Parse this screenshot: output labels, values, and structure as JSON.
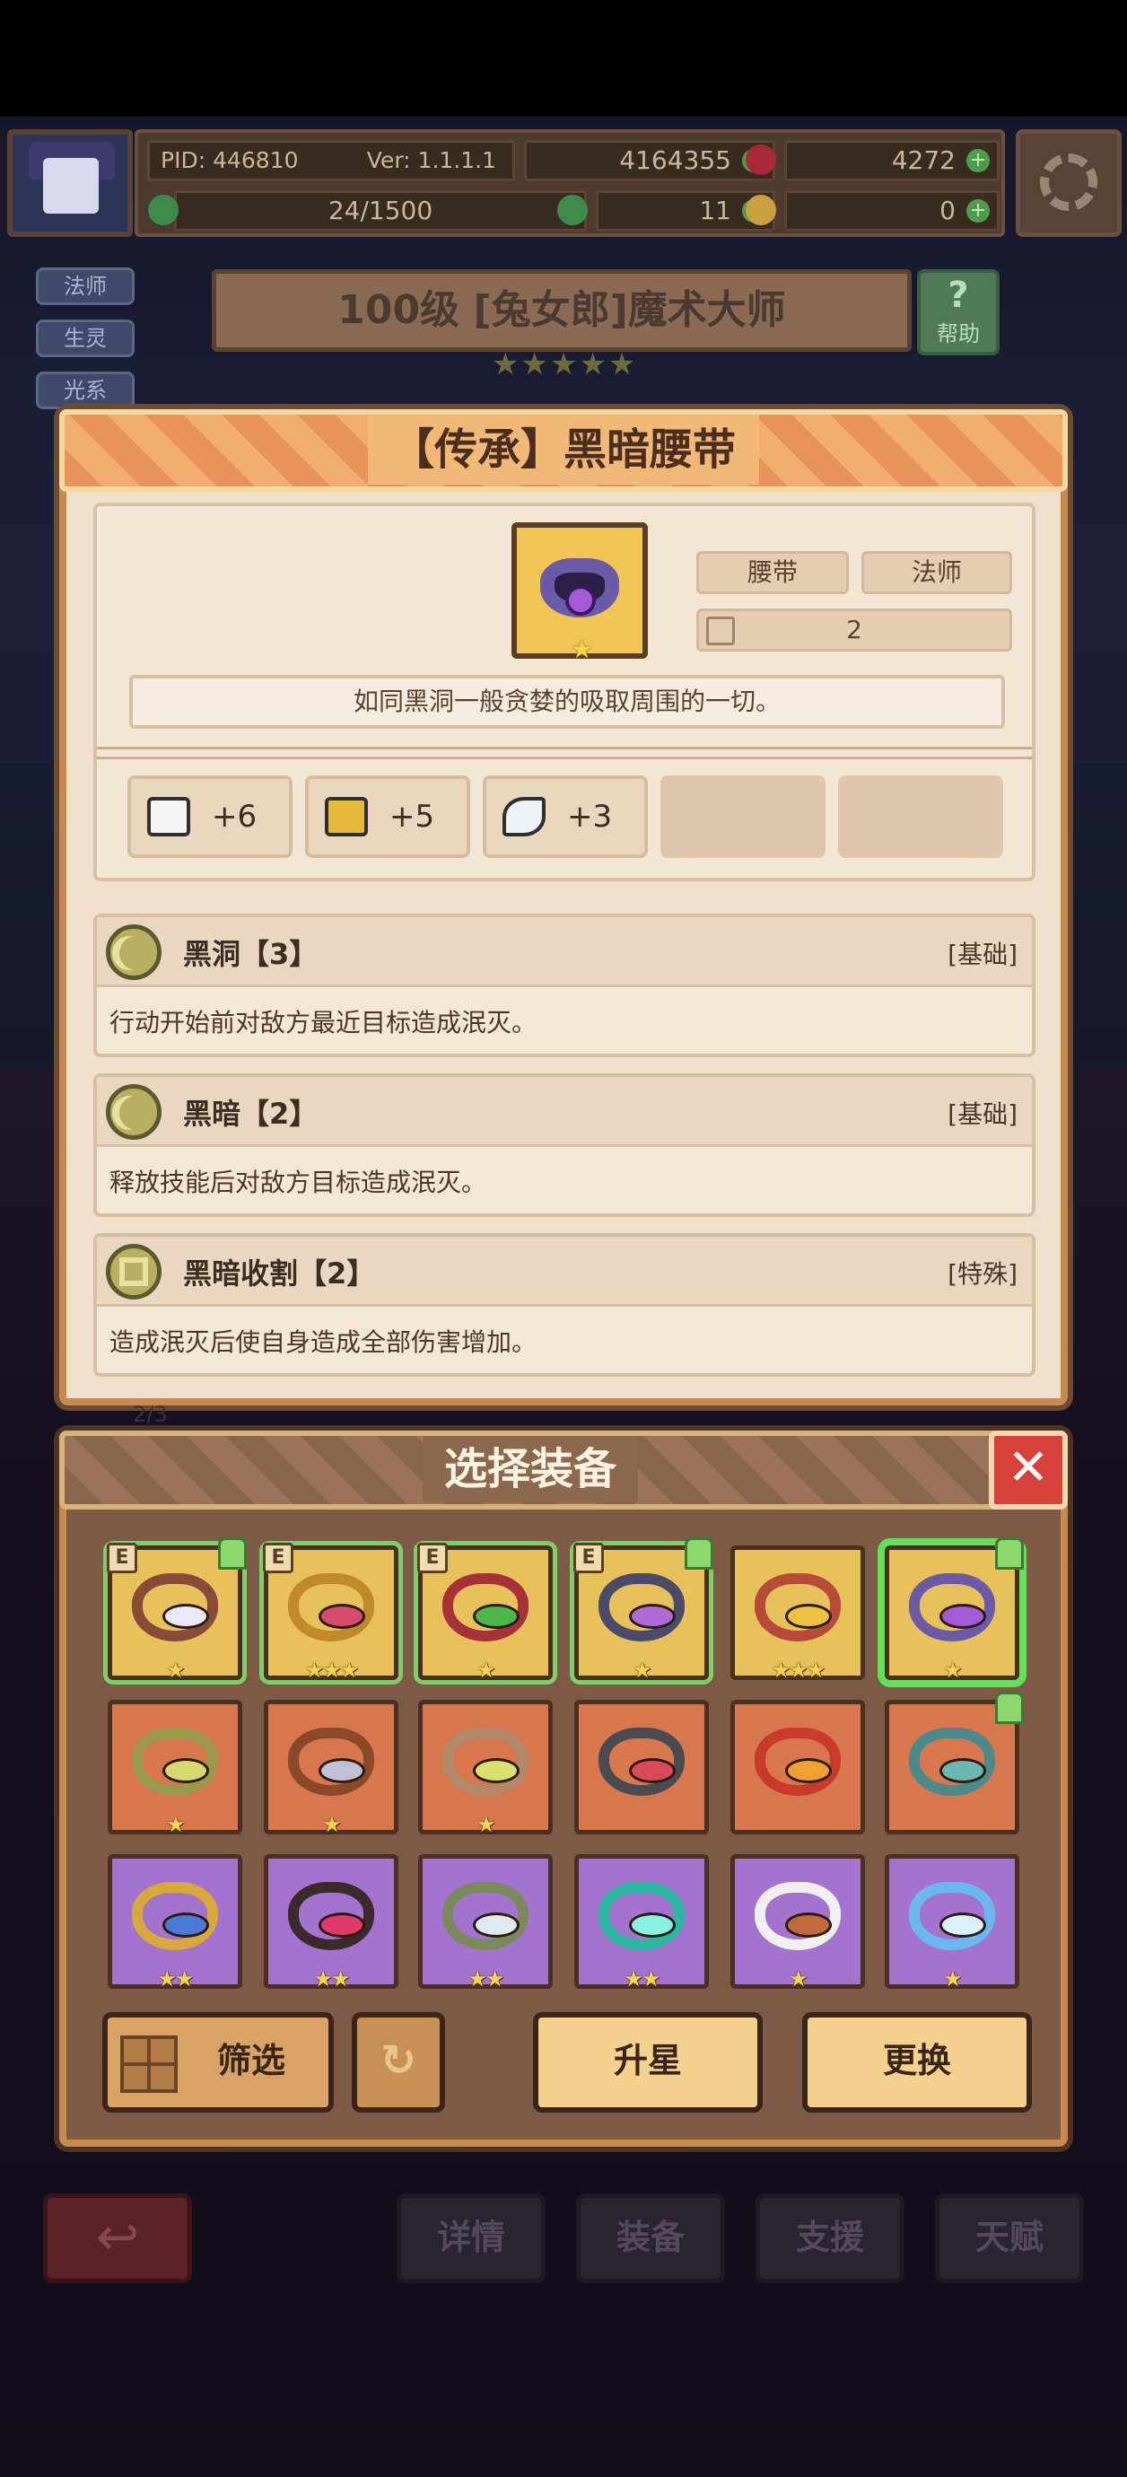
{
  "hud": {
    "pid": "PID: 446810",
    "version": "Ver: 1.1.1.1",
    "gold": "4164355",
    "gems": "4272",
    "energy": "24/1500",
    "clover": "11",
    "keys": "0"
  },
  "hero": {
    "tags": [
      "法师",
      "生灵",
      "光系"
    ],
    "title": "100级 [兔女郎]魔术大师",
    "stars": "★★★★★",
    "help_label": "帮助",
    "help_glyph": "?"
  },
  "item_detail": {
    "title": "【传承】黑暗腰带",
    "type": "腰带",
    "class": "法师",
    "owned_count": "2",
    "icon_star": "★",
    "description": "如同黑洞一般贪婪的吸取周围的一切。",
    "stats": [
      {
        "icon": "book-icon",
        "value": "+6"
      },
      {
        "icon": "boot-icon",
        "value": "+5"
      },
      {
        "icon": "feather-icon",
        "value": "+3"
      }
    ],
    "skills": [
      {
        "icon": "moon-icon",
        "name": "黑洞【3】",
        "type": "[基础]",
        "desc": "行动开始前对敌方最近目标造成泯灭。"
      },
      {
        "icon": "moon-icon",
        "name": "黑暗【2】",
        "type": "[基础]",
        "desc": "释放技能后对敌方目标造成泯灭。"
      },
      {
        "icon": "square-ring-icon",
        "name": "黑暗收割【2】",
        "type": "[特殊]",
        "desc": "造成泯灭后使自身造成全部伤害增加。"
      }
    ]
  },
  "select_panel": {
    "title": "选择装备",
    "close_glyph": "✕",
    "equipped_badge": "E",
    "slots": [
      {
        "rarity": "gold",
        "equipped": true,
        "upgrade": true,
        "stars": "★",
        "band": "#8a4a3a",
        "gem": "#e9e9f5"
      },
      {
        "rarity": "gold",
        "equipped": true,
        "upgrade": false,
        "stars": "★★★",
        "band": "#c08a2a",
        "gem": "#d64a6a"
      },
      {
        "rarity": "gold",
        "equipped": true,
        "upgrade": false,
        "stars": "★",
        "band": "#a8303a",
        "gem": "#4ab84a"
      },
      {
        "rarity": "gold",
        "equipped": true,
        "upgrade": true,
        "stars": "★",
        "band": "#4a4a6a",
        "gem": "#b06ad8"
      },
      {
        "rarity": "gold",
        "equipped": false,
        "upgrade": false,
        "stars": "★★★",
        "band": "#b84a3a",
        "gem": "#f0c040"
      },
      {
        "rarity": "gold",
        "equipped": false,
        "upgrade": true,
        "selected": true,
        "stars": "★",
        "band": "#6b5aa8",
        "gem": "#a35ad6"
      },
      {
        "rarity": "orange",
        "equipped": false,
        "upgrade": false,
        "stars": "★",
        "band": "#9a9a4a",
        "gem": "#d8d870"
      },
      {
        "rarity": "orange",
        "equipped": false,
        "upgrade": false,
        "stars": "★",
        "band": "#8a4a2a",
        "gem": "#c0c0d8"
      },
      {
        "rarity": "orange",
        "equipped": false,
        "upgrade": false,
        "stars": "★",
        "band": "#b08a6a",
        "gem": "#d8e070"
      },
      {
        "rarity": "orange",
        "equipped": false,
        "upgrade": false,
        "stars": "",
        "band": "#4a4a52",
        "gem": "#d84a5a"
      },
      {
        "rarity": "orange",
        "equipped": false,
        "upgrade": false,
        "stars": "",
        "band": "#c83a2a",
        "gem": "#f0a030"
      },
      {
        "rarity": "orange",
        "equipped": false,
        "upgrade": true,
        "stars": "",
        "band": "#4a8a8a",
        "gem": "#6ab8b0"
      },
      {
        "rarity": "purple",
        "equipped": false,
        "upgrade": false,
        "stars": "★★",
        "band": "#d8a83a",
        "gem": "#4a7ad8"
      },
      {
        "rarity": "purple",
        "equipped": false,
        "upgrade": false,
        "stars": "★★",
        "band": "#3a2a2a",
        "gem": "#e03a6a"
      },
      {
        "rarity": "purple",
        "equipped": false,
        "upgrade": false,
        "stars": "★★",
        "band": "#7a8a5a",
        "gem": "#e0e8f0"
      },
      {
        "rarity": "purple",
        "equipped": false,
        "upgrade": false,
        "stars": "★★",
        "band": "#2ab8a0",
        "gem": "#8af0e0"
      },
      {
        "rarity": "purple",
        "equipped": false,
        "upgrade": false,
        "stars": "★",
        "band": "#f0f0f0",
        "gem": "#c06a3a"
      },
      {
        "rarity": "purple",
        "equipped": false,
        "upgrade": false,
        "stars": "★",
        "band": "#6ab8f0",
        "gem": "#d8f0ff"
      }
    ],
    "filter_label": "筛选",
    "refresh_glyph": "↻",
    "star_up_label": "升星",
    "swap_label": "更换"
  },
  "nav": {
    "back_glyph": "↩",
    "fragment": "2/3",
    "items": [
      "详情",
      "装备",
      "支援",
      "天赋"
    ]
  },
  "colors": {
    "detail_border": "#c88a4e",
    "header_orange": "#e8935b",
    "panel_bg": "#f0dfca",
    "select_bg": "#7c5a45",
    "close_red": "#d8403a",
    "selected_green": "#5fe25a"
  }
}
